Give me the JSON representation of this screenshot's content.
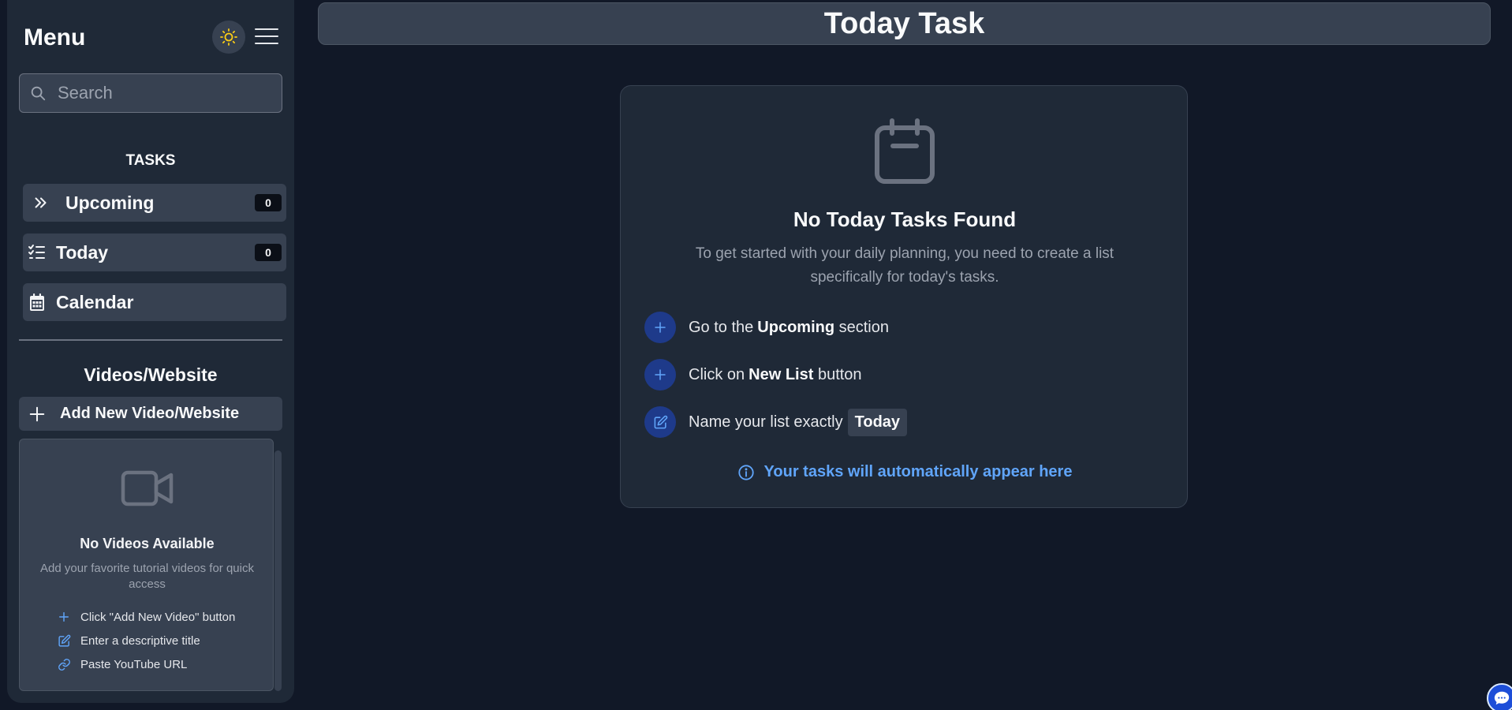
{
  "sidebar": {
    "title": "Menu",
    "search": {
      "placeholder": "Search",
      "value": ""
    },
    "tasks_heading": "TASKS",
    "nav": [
      {
        "label": "Upcoming",
        "count": "0",
        "icon": "chevrons-right-icon"
      },
      {
        "label": "Today",
        "count": "0",
        "icon": "list-checks-icon"
      },
      {
        "label": "Calendar",
        "icon": "calendar-icon"
      }
    ],
    "videos_heading": "Videos/Website",
    "add_video_label": "Add New Video/Website",
    "videos_empty": {
      "title": "No Videos Available",
      "description": "Add your favorite tutorial videos for quick access",
      "steps": [
        "Click \"Add New Video\" button",
        "Enter a descriptive title",
        "Paste YouTube URL"
      ]
    }
  },
  "header": {
    "title": "Today Task"
  },
  "empty_state": {
    "title": "No Today Tasks Found",
    "description": "To get started with your daily planning, you need to create a list specifically for today's tasks.",
    "steps": [
      {
        "pre": "Go to the ",
        "bold": "Upcoming",
        "post": " section",
        "icon": "plus-icon"
      },
      {
        "pre": "Click on ",
        "bold": "New List",
        "post": " button",
        "icon": "plus-icon"
      },
      {
        "pre": "Name your list exactly ",
        "chip": "Today",
        "icon": "edit-icon"
      }
    ],
    "info": "Your tasks will automatically appear here"
  },
  "colors": {
    "background": "#111827",
    "panel": "#1f2937",
    "surface": "#374151",
    "accent_blue": "#60a5fa",
    "sun_yellow": "#facc15"
  }
}
